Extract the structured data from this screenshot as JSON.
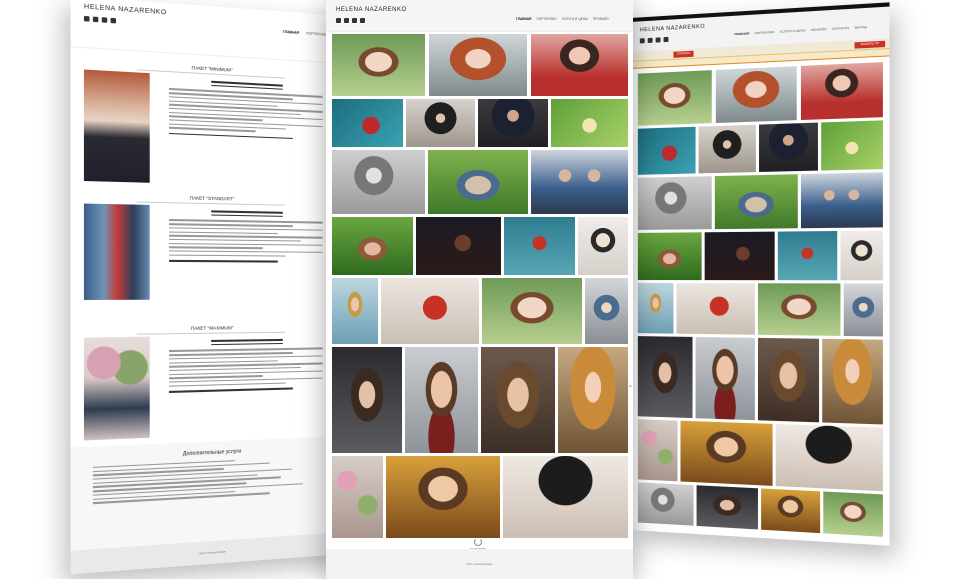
{
  "site": {
    "brand": "HELENA NAZARENKO"
  },
  "social_icons": [
    "vk-icon",
    "facebook-icon",
    "twitter-icon",
    "instagram-icon"
  ],
  "nav": {
    "items": [
      "ГЛАВНАЯ",
      "ПОРТФОЛИО",
      "УСЛУГИ И ЦЕНЫ",
      "ПРОФАЙЛ",
      "КОНТАКТЫ",
      "ВЫХОД"
    ]
  },
  "left_page": {
    "packages": [
      {
        "title": "ПАКЕТ \"MINIMUM\"",
        "price_label": "*стоимость*",
        "price": "15 000 руб.",
        "note": "Подходит для единичной съёмки, мини с ребёнком."
      },
      {
        "title": "ПАКЕТ \"STANDART\"",
        "price_label": "*стоимость*",
        "price": "18 000 руб.",
        "note": "Подходит для семьи до 4 человек."
      },
      {
        "title": "ПАКЕТ \"MAXIMUM\"",
        "price_label": "*стоимость*",
        "price": "24 000 руб.",
        "note": "Подходит для индивидуальной или семейной съёмки."
      }
    ],
    "additional_title": "Дополнительные услуги",
    "footer": "сайт о печатной цвие"
  },
  "center_page": {
    "load_more": "ЗАГРУЗИТЬ",
    "footer": "сайт о печатной цвие"
  },
  "right_page": {
    "ask_button": "СПРОСИТЬ",
    "order_button": "ЗАКАЗАТЬ ТУР"
  },
  "colors": {
    "accent": "#c83226",
    "notice_border": "#e08a1e",
    "footer_bg": "#e9e9ea"
  }
}
